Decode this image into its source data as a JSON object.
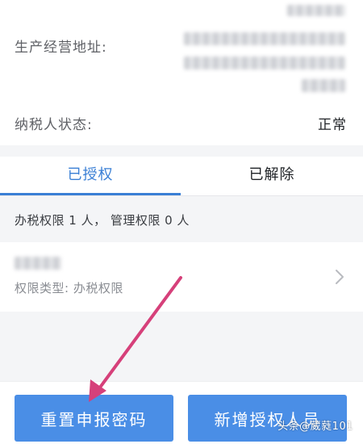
{
  "info": {
    "address_label": "生产经营地址:",
    "status_label": "纳税人状态:",
    "status_value": "正常"
  },
  "tabs": [
    {
      "label": "已授权",
      "active": true
    },
    {
      "label": "已解除",
      "active": false
    }
  ],
  "summary": "办税权限 1 人， 管理权限 0 人",
  "authorized_person": {
    "permission_type": "权限类型: 办税权限"
  },
  "buttons": {
    "reset": "重置申报密码",
    "add": "新增授权人员"
  },
  "watermark": "头条@葳蕤101",
  "colors": {
    "accent": "#3a7fd5",
    "button": "#4a8ee6",
    "annotation_arrow": "#d6407a"
  },
  "icons": {
    "row_chevron": "chevron-right-icon",
    "annotation": "annotation-arrow-icon"
  }
}
